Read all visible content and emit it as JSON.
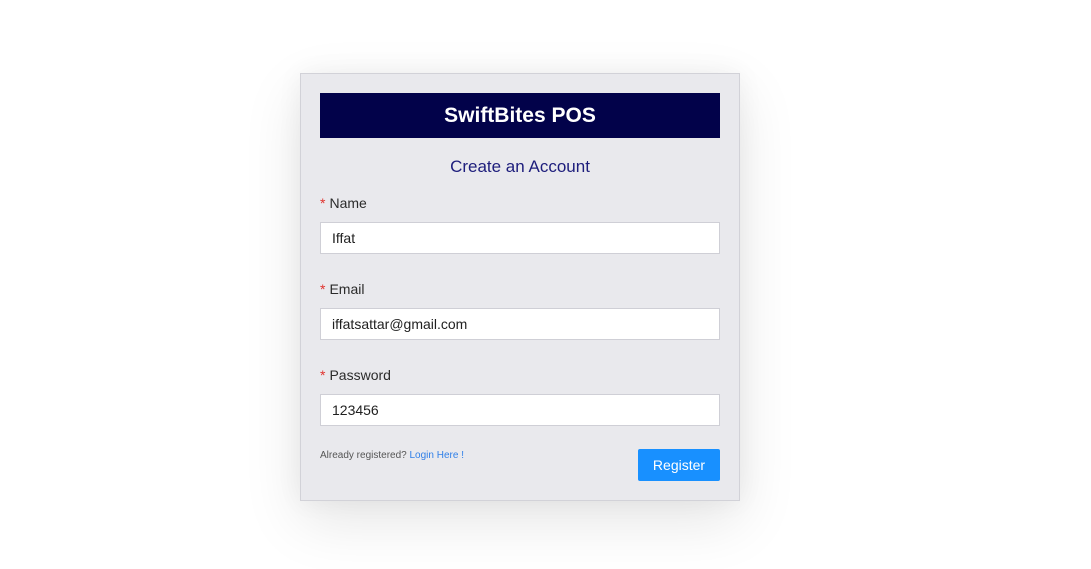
{
  "app": {
    "title": "SwiftBites POS",
    "subtitle": "Create an Account"
  },
  "form": {
    "required_marker": "*",
    "name": {
      "label": "Name",
      "value": "Iffat"
    },
    "email": {
      "label": "Email",
      "value": "iffatsattar@gmail.com"
    },
    "password": {
      "label": "Password",
      "value": "123456"
    }
  },
  "footer": {
    "already_text": "Already registered?",
    "login_link": "Login Here !",
    "register_label": "Register"
  },
  "colors": {
    "header_bg": "#02024a",
    "card_bg": "#e9e9ed",
    "accent": "#1890ff",
    "required": "#e0322d",
    "link": "#2f7fe8"
  }
}
